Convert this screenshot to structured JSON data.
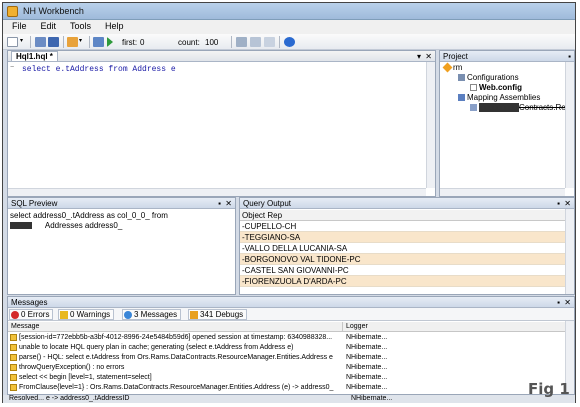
{
  "window": {
    "title": "NH Workbench"
  },
  "menu": {
    "items": [
      "File",
      "Edit",
      "Tools",
      "Help"
    ]
  },
  "toolbar": {
    "first_label": "first:",
    "first_value": "0",
    "count_label": "count:",
    "count_value": "100"
  },
  "editor": {
    "tab_label": "Hql1.hql *",
    "code": "select e.tAddress from Address e"
  },
  "project": {
    "header": "Project",
    "tree": [
      {
        "label": "rm"
      },
      {
        "label": "Configurations"
      },
      {
        "label": "Web.config"
      },
      {
        "label": "Mapping Assemblies"
      },
      {
        "label": "Contracts.Ress"
      }
    ]
  },
  "sql_preview": {
    "header": "SQL Preview",
    "lines": [
      "select address0_.tAddress as col_0_0_ from",
      "      Addresses address0_"
    ]
  },
  "query_output": {
    "header": "Query Output",
    "column": "Object Rep",
    "rows": [
      "-CUPELLO-CH",
      "-TEGGIANO-SA",
      "-VALLO DELLA LUCANIA-SA",
      "-BORGONOVO VAL TIDONE-PC",
      "-CASTEL SAN GIOVANNI-PC",
      "-FIORENZUOLA D'ARDA-PC"
    ]
  },
  "messages": {
    "header": "Messages",
    "filters": [
      {
        "label": "0 Errors",
        "color": "#d42a2a"
      },
      {
        "label": "0 Warnings",
        "color": "#e8b820"
      },
      {
        "label": "3 Messages",
        "color": "#3a86d8"
      },
      {
        "label": "341 Debugs",
        "color": "#e8a020"
      }
    ],
    "columns": {
      "message": "Message",
      "logger": "Logger"
    },
    "rows": [
      {
        "text": "[session-id=772ebb5b-a3bf-4012-8996-24e5484b59d6] opened session at timestamp: 6340988328...",
        "logger": "NHibernate..."
      },
      {
        "text": "unable to locate HQL query plan in cache; generating (select e.tAddress from Address e)",
        "logger": "NHibernate..."
      },
      {
        "text": "parse() - HQL: select e.tAddress from Ors.Rams.DataContracts.ResourceManager.Entities.Address e",
        "logger": "NHibernate..."
      },
      {
        "text": "throwQueryException() : no errors",
        "logger": "NHibernate..."
      },
      {
        "text": "select << begin [level=1, statement=select]",
        "logger": "NHibernate..."
      },
      {
        "text": "FromClause{level=1} : Ors.Rams.DataContracts.ResourceManager.Entities.Address (e) -> address0_",
        "logger": "NHibernate..."
      },
      {
        "text": "Resolved... e -> address0_.tAddressID",
        "logger": "NHibernate..."
      }
    ]
  },
  "figure_label": "Fig 1"
}
